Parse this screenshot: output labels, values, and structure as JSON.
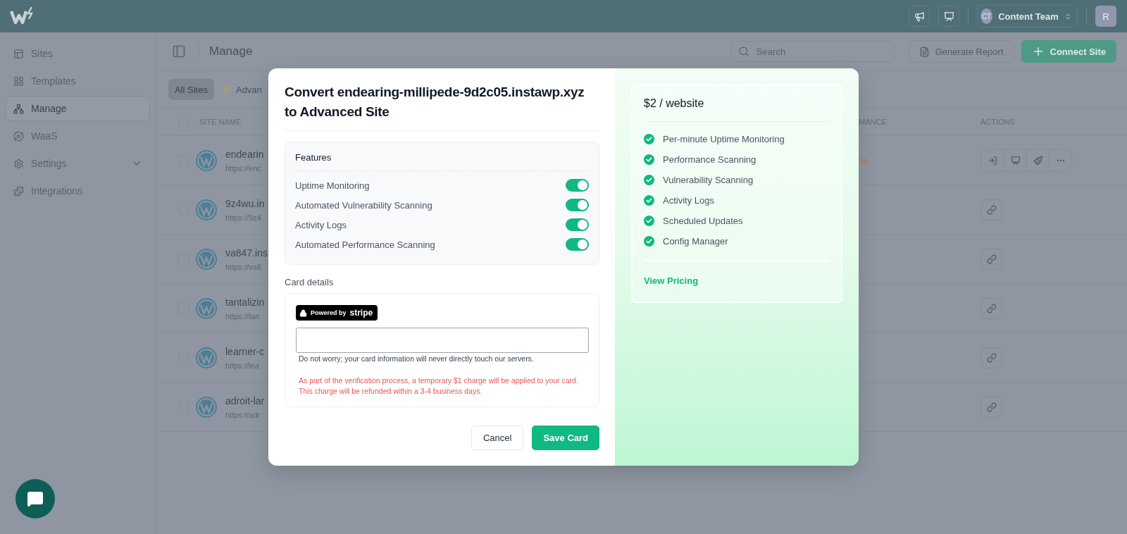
{
  "topbar": {
    "team": {
      "initials": "CT",
      "name": "Content Team"
    },
    "avatar": "R"
  },
  "sidebar": {
    "items": [
      {
        "label": "Sites",
        "kind": "link",
        "selected": false
      },
      {
        "label": "Templates",
        "kind": "link",
        "selected": false
      },
      {
        "label": "Manage",
        "kind": "link",
        "selected": true
      },
      {
        "label": "WaaS",
        "kind": "link",
        "selected": false
      },
      {
        "label": "Settings",
        "kind": "group",
        "selected": false,
        "expanded": false
      },
      {
        "label": "Integrations",
        "kind": "link",
        "selected": false
      }
    ]
  },
  "header": {
    "title": "Manage",
    "search": {
      "placeholder": "Search"
    },
    "buttons": [
      {
        "label": "Generate Report",
        "kind": "secondary"
      },
      {
        "label": "Connect Site",
        "kind": "primary"
      }
    ]
  },
  "filter_tabs": [
    {
      "label": "All Sites",
      "selected": true
    },
    {
      "label": "Advan",
      "selected": false
    }
  ],
  "table": {
    "columns": [
      "SITE NAME",
      "MANCE",
      "ACTIONS"
    ],
    "header_checked": false,
    "rows": [
      {
        "name": "endearin",
        "url": "https://enc",
        "checked": false,
        "column_3": "%",
        "kind": "toolbar"
      },
      {
        "name": "9z4wu.in",
        "url": "https://9z4",
        "checked": false,
        "kind": "link"
      },
      {
        "name": "va847.ins",
        "url": "https://va8",
        "checked": false,
        "kind": "link"
      },
      {
        "name": "tantalizin",
        "url": "https://tan",
        "checked": false,
        "kind": "link"
      },
      {
        "name": "learner-c",
        "url": "https://lea",
        "checked": false,
        "kind": "link"
      },
      {
        "name": "adroit-lar",
        "url": "https://adr",
        "checked": false,
        "kind": "link"
      }
    ]
  },
  "modal": {
    "title": "Convert endearing-millipede-9d2c05.instawp.xyz to Advanced Site",
    "features": {
      "heading": "Features",
      "items": [
        {
          "label": "Uptime Monitoring",
          "on": true
        },
        {
          "label": "Automated Vulnerability Scanning",
          "on": true
        },
        {
          "label": "Activity Logs",
          "on": true
        },
        {
          "label": "Automated Performance Scanning",
          "on": true
        }
      ]
    },
    "card": {
      "label": "Card details",
      "badge": {
        "prefix": "Powered by",
        "brand": "stripe"
      },
      "note": "Do not worry; your card information will never directly touch our servers.",
      "warning": "As part of the verification process, a temporary $1 charge will be applied to your card. This charge will be refunded within a 3-4 business days."
    },
    "buttons": [
      {
        "label": "Cancel",
        "kind": "secondary"
      },
      {
        "label": "Save Card",
        "kind": "primary"
      }
    ],
    "plan": {
      "price": "$2 / website",
      "features": [
        "Per-minute Uptime Monitoring",
        "Performance Scanning",
        "Vulnerability Scanning",
        "Activity Logs",
        "Scheduled Updates",
        "Config Manager"
      ],
      "link": "View Pricing"
    }
  }
}
